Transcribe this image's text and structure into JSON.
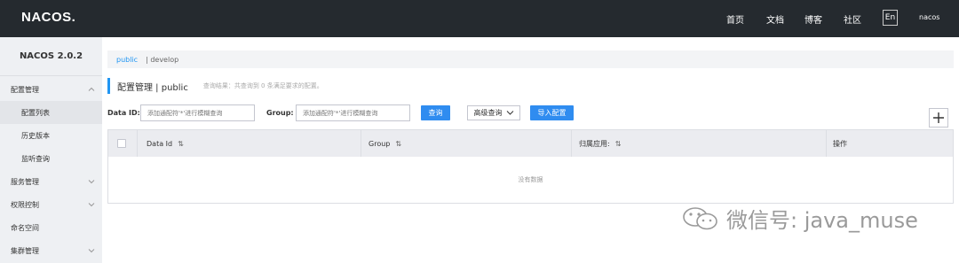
{
  "topbar": {
    "logo": "NACOS.",
    "nav": [
      "首页",
      "文档",
      "博客",
      "社区"
    ],
    "lang": "En",
    "user": "nacos"
  },
  "sidebar": {
    "version": "NACOS 2.0.2",
    "items": [
      {
        "label": "配置管理",
        "type": "parent",
        "expanded": true
      },
      {
        "label": "配置列表",
        "type": "child",
        "active": true
      },
      {
        "label": "历史版本",
        "type": "child"
      },
      {
        "label": "监听查询",
        "type": "child"
      },
      {
        "label": "服务管理",
        "type": "parent"
      },
      {
        "label": "权限控制",
        "type": "parent"
      },
      {
        "label": "命名空间",
        "type": "parent"
      },
      {
        "label": "集群管理",
        "type": "parent"
      }
    ]
  },
  "breadcrumb": {
    "active": "public",
    "other": "| develop"
  },
  "page": {
    "title": "配置管理  |  public",
    "hint": "查询结果：共查询到 0 条满足要求的配置。"
  },
  "filters": {
    "data_id_label": "Data ID:",
    "data_id_placeholder": "添加通配符'*'进行模糊查询",
    "group_label": "Group:",
    "group_placeholder": "添加通配符'*'进行模糊查询",
    "search_btn": "查询",
    "advanced_btn": "高级查询",
    "import_btn": "导入配置"
  },
  "table": {
    "columns": [
      "Data Id",
      "Group",
      "归属应用:",
      "操作"
    ],
    "empty": "没有数据"
  },
  "watermark": "微信号: java_muse",
  "colors": {
    "topbar": "#252a2f",
    "accent": "#2196f3",
    "primary_button": "#2f8cf0",
    "sidebar": "#eef0f3"
  }
}
